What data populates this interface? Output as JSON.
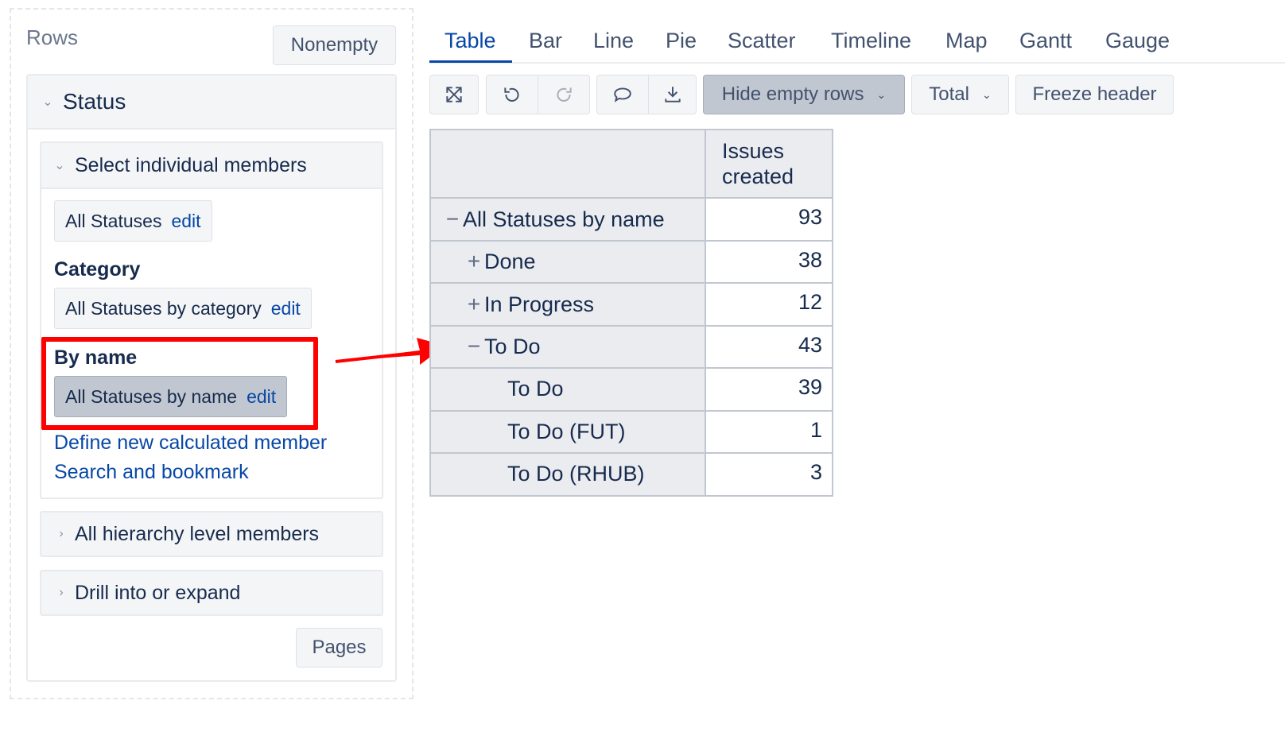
{
  "left": {
    "rows_title": "Rows",
    "nonempty_label": "Nonempty",
    "status_title": "Status",
    "select_members_title": "Select individual members",
    "all_statuses_chip": {
      "label": "All Statuses",
      "edit": "edit"
    },
    "category_label": "Category",
    "category_chip": {
      "label": "All Statuses by category",
      "edit": "edit"
    },
    "by_name_label": "By name",
    "by_name_chip": {
      "label": "All Statuses by name",
      "edit": "edit"
    },
    "define_calc_link": "Define new calculated member",
    "search_bookmark_link": "Search and bookmark",
    "all_hierarchy_title": "All hierarchy level members",
    "drill_title": "Drill into or expand",
    "pages_label": "Pages"
  },
  "tabs": [
    "Table",
    "Bar",
    "Line",
    "Pie",
    "Scatter",
    "Timeline",
    "Map",
    "Gantt",
    "Gauge"
  ],
  "active_tab": "Table",
  "toolbar": {
    "icons": [
      "expand-icon",
      "undo-icon",
      "redo-icon",
      "comment-icon",
      "download-icon"
    ],
    "hide_empty_rows": "Hide empty rows",
    "total": "Total",
    "freeze_header": "Freeze header"
  },
  "table": {
    "column_header_line1": "Issues",
    "column_header_line2": "created",
    "rows": [
      {
        "symbol": "−",
        "label": "All Statuses by name",
        "value": "93"
      },
      {
        "symbol": "+",
        "label": "Done",
        "value": "38"
      },
      {
        "symbol": "+",
        "label": "In Progress",
        "value": "12"
      },
      {
        "symbol": "−",
        "label": "To Do",
        "value": "43"
      },
      {
        "symbol": "",
        "label": "To Do",
        "value": "39"
      },
      {
        "symbol": "",
        "label": "To Do (FUT)",
        "value": "1"
      },
      {
        "symbol": "",
        "label": "To Do (RHUB)",
        "value": "3"
      }
    ]
  },
  "colors": {
    "highlight": "#ff0000",
    "link": "#0747a6",
    "arrow": "#ff0000"
  }
}
